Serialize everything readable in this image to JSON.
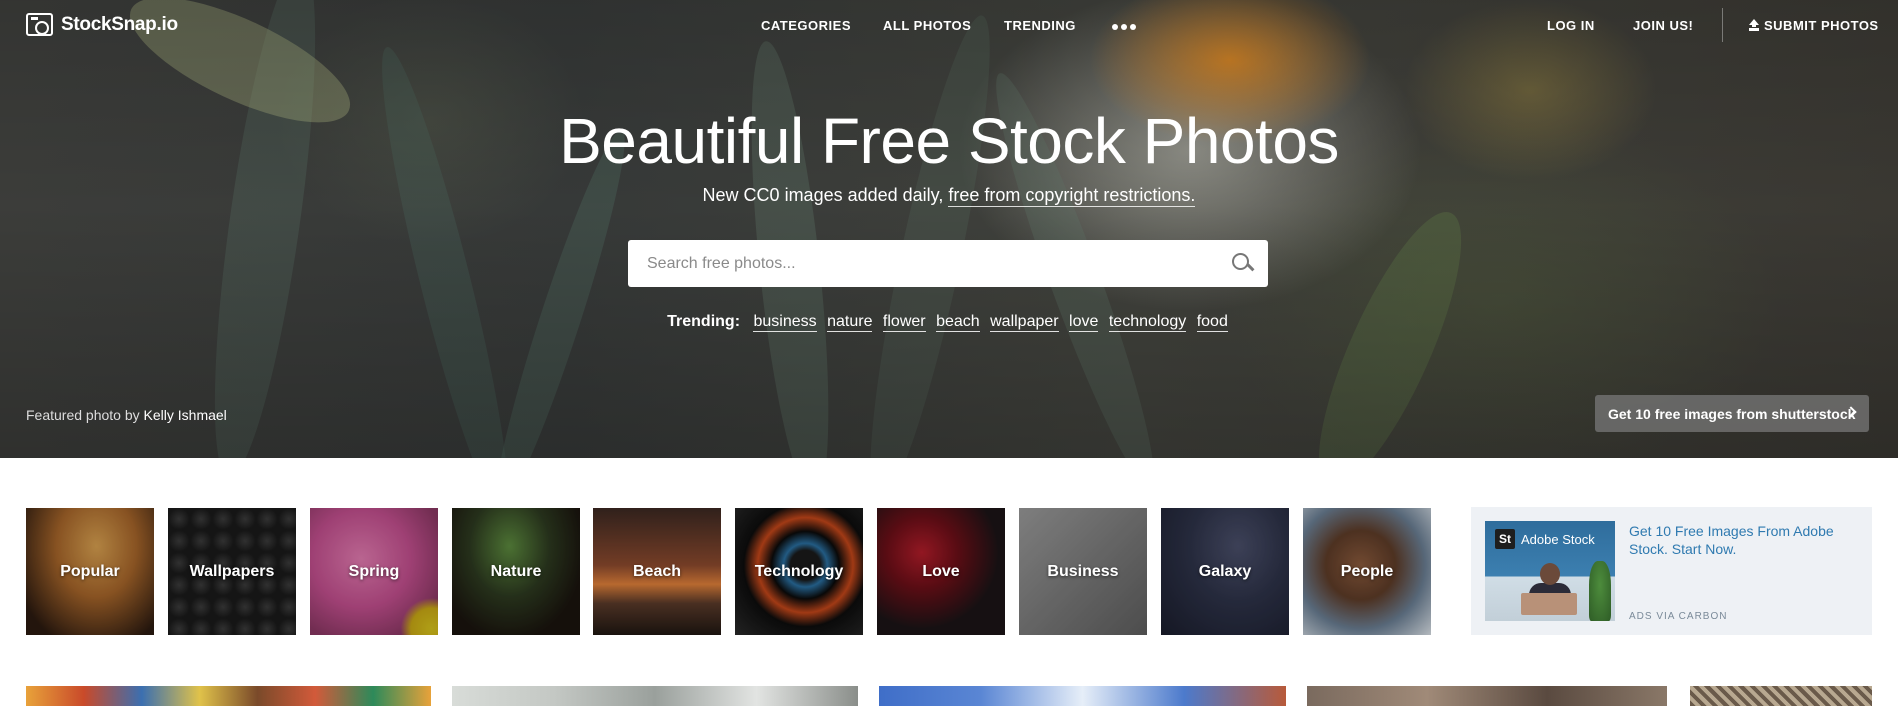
{
  "nav": {
    "logo": "StockSnap.io",
    "links": [
      "CATEGORIES",
      "ALL PHOTOS",
      "TRENDING"
    ],
    "login": "LOG IN",
    "join": "JOIN US!",
    "submit": "SUBMIT PHOTOS"
  },
  "hero": {
    "title": "Beautiful Free Stock Photos",
    "subtitle_prefix": "New CC0 images added daily,",
    "subtitle_link": "free from copyright restrictions.",
    "search_placeholder": "Search free photos...",
    "trending_label": "Trending:",
    "trending_tags": [
      "business",
      "nature",
      "flower",
      "beach",
      "wallpaper",
      "love",
      "technology",
      "food"
    ],
    "credit_prefix": "Featured photo by",
    "credit_name": "Kelly Ishmael",
    "shutterstock_button": "Get 10 free images from shutterstock"
  },
  "categories": [
    "Popular",
    "Wallpapers",
    "Spring",
    "Nature",
    "Beach",
    "Technology",
    "Love",
    "Business",
    "Galaxy",
    "People"
  ],
  "ad": {
    "badge": "Adobe Stock",
    "badge_logo": "St",
    "text": "Get 10 Free Images From Adobe Stock. Start Now.",
    "via": "ADS VIA CARBON"
  },
  "colors": {
    "ad_link": "#2f7ab0",
    "ad_bg": "#eef1f5"
  }
}
